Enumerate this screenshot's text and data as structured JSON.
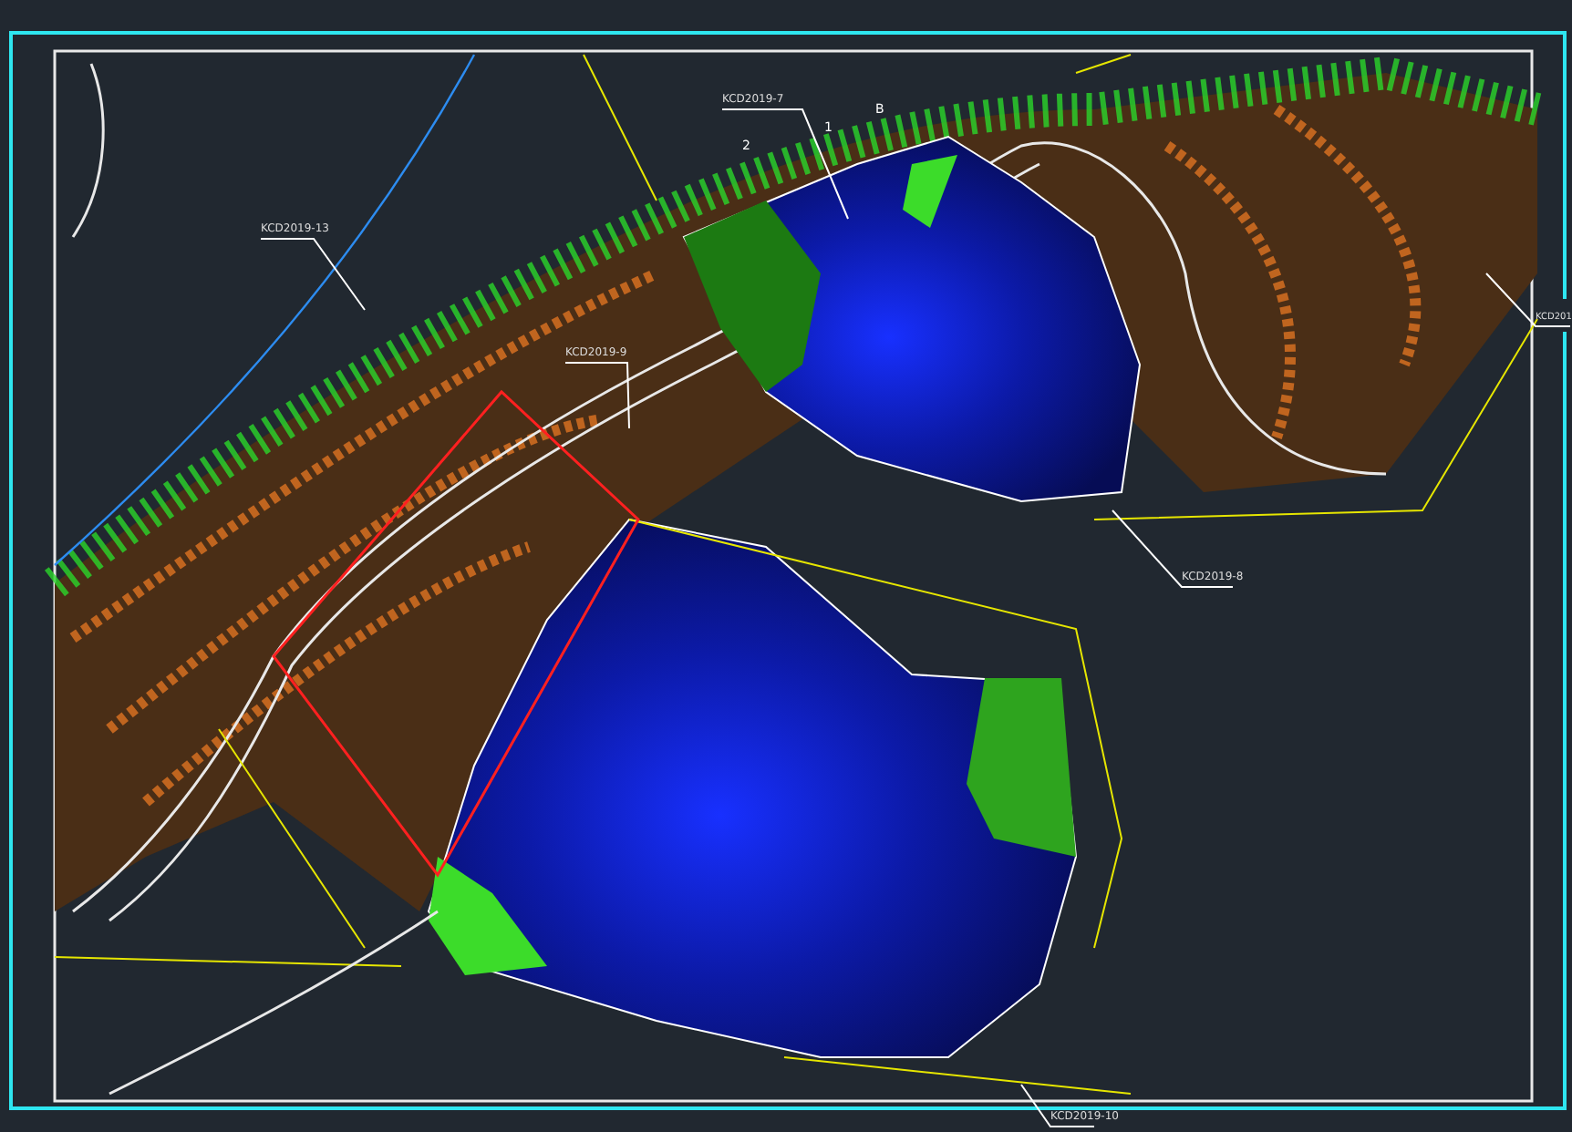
{
  "drawing": {
    "labels": [
      {
        "text": "KCD2019-7"
      },
      {
        "text": "KCD2019-13"
      },
      {
        "text": "KCD2019-9"
      },
      {
        "text": "KCD2019-8"
      },
      {
        "text": "KCD2019-10"
      },
      {
        "text": "KCD201"
      }
    ],
    "markers": [
      {
        "text": "1"
      },
      {
        "text": "2"
      },
      {
        "text": "B"
      }
    ]
  }
}
